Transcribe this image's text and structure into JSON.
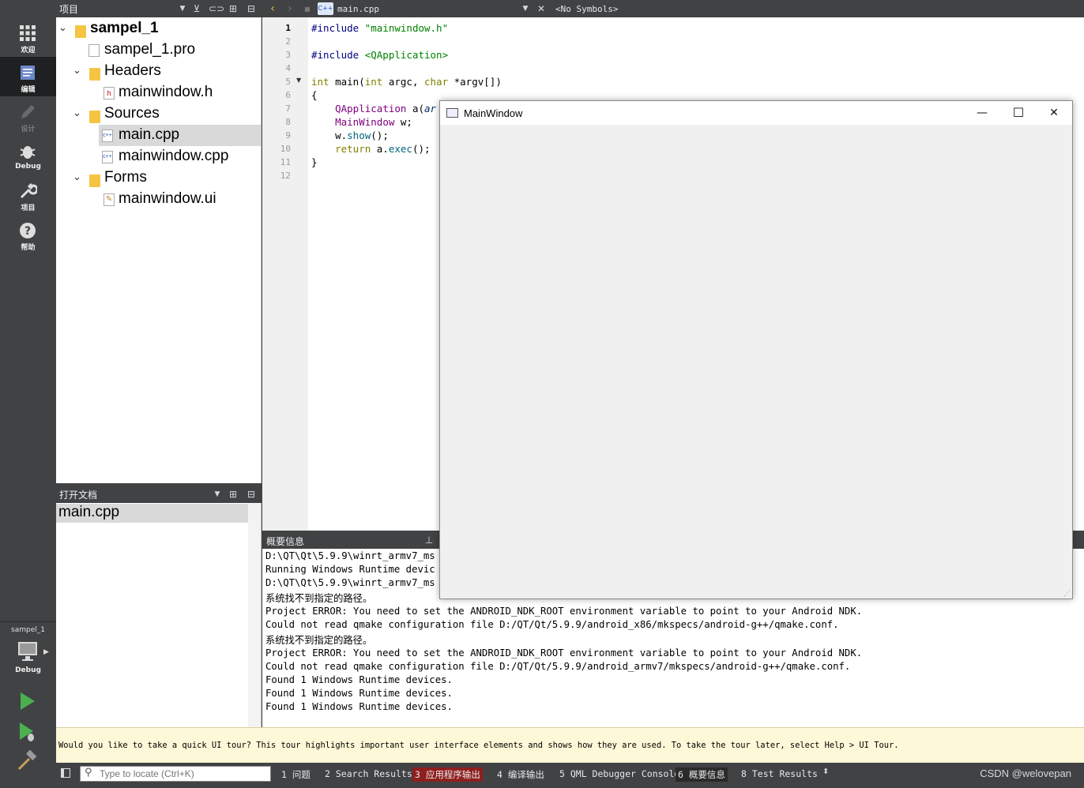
{
  "modebar": {
    "items": [
      {
        "label": "欢迎",
        "icon": "grid-icon"
      },
      {
        "label": "编辑",
        "icon": "edit-doc-icon"
      },
      {
        "label": "设计",
        "icon": "pencil-icon"
      },
      {
        "label": "Debug",
        "icon": "bug-icon"
      },
      {
        "label": "项目",
        "icon": "wrench-icon"
      },
      {
        "label": "帮助",
        "icon": "help-icon"
      }
    ],
    "kit": {
      "project": "sampel_1",
      "mode": "Debug"
    }
  },
  "project_panel": {
    "title": "项目",
    "tree": [
      {
        "label": "sampel_1"
      },
      {
        "label": "sampel_1.pro"
      },
      {
        "label": "Headers"
      },
      {
        "label": "mainwindow.h"
      },
      {
        "label": "Sources"
      },
      {
        "label": "main.cpp"
      },
      {
        "label": "mainwindow.cpp"
      },
      {
        "label": "Forms"
      },
      {
        "label": "mainwindow.ui"
      }
    ]
  },
  "open_docs": {
    "title": "打开文档",
    "items": [
      "main.cpp"
    ]
  },
  "editor": {
    "file": "main.cpp",
    "symbols": "<No Symbols>",
    "current_line": "1",
    "line_numbers": [
      "1",
      "2",
      "3",
      "4",
      "5",
      "6",
      "7",
      "8",
      "9",
      "10",
      "11",
      "12"
    ],
    "code": {
      "l1a": "#include ",
      "l1b": "\"mainwindow.h\"",
      "l3a": "#include ",
      "l3b": "<QApplication>",
      "l5a": "int",
      "l5b": " main(",
      "l5c": "int",
      "l5d": " argc, ",
      "l5e": "char",
      "l5f": " *argv[])",
      "l6": "{",
      "l7a": "    ",
      "l7b": "QApplication",
      "l7c": " a(",
      "l7d": "ar",
      "l8a": "    ",
      "l8b": "MainWindow",
      "l8c": " w;",
      "l9a": "    w.",
      "l9b": "show",
      "l9c": "();",
      "l10a": "    ",
      "l10b": "return",
      "l10c": " a.",
      "l10d": "exec",
      "l10e": "();",
      "l11": "}"
    }
  },
  "output": {
    "title": "概要信息",
    "lines": [
      "D:\\QT\\Qt\\5.9.9\\winrt_armv7_ms",
      "Running Windows Runtime devic",
      "D:\\QT\\Qt\\5.9.9\\winrt_armv7_ms",
      "系统找不到指定的路径。",
      "Project ERROR: You need to set the ANDROID_NDK_ROOT environment variable to point to your Android NDK.",
      "Could not read qmake configuration file D:/QT/Qt/5.9.9/android_x86/mkspecs/android-g++/qmake.conf.",
      "系统找不到指定的路径。",
      "Project ERROR: You need to set the ANDROID_NDK_ROOT environment variable to point to your Android NDK.",
      "Could not read qmake configuration file D:/QT/Qt/5.9.9/android_armv7/mkspecs/android-g++/qmake.conf.",
      "Found 1 Windows Runtime devices.",
      "Found 1 Windows Runtime devices.",
      "Found 1 Windows Runtime devices."
    ]
  },
  "infobar": {
    "message": "Would you like to take a quick UI tour? This tour highlights important user interface elements and shows how they are used. To take the tour later, select Help > UI Tour."
  },
  "statusbar": {
    "locator_placeholder": "Type to locate (Ctrl+K)",
    "tabs": [
      "1 问题",
      "2 Search Results",
      "3 应用程序输出",
      "4 编译输出",
      "5 QML Debugger Console",
      "6 概要信息",
      "8 Test Results"
    ],
    "watermark": "CSDN @welovepan"
  },
  "mainwindow": {
    "title": "MainWindow",
    "minimize": "—",
    "maximize": "☐",
    "close": "✕"
  },
  "colors": {
    "sidebar": "#404244",
    "active_mode": "#1f2021",
    "error_tab": "#8f1f1f",
    "run_green": "#4caf50"
  }
}
